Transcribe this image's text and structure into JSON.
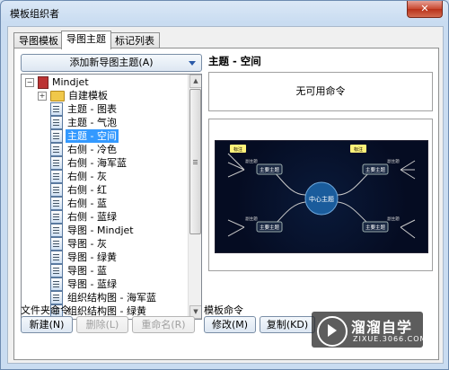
{
  "window": {
    "title": "模板组织者",
    "close_label": "✕"
  },
  "tabs": [
    {
      "label": "导图模板",
      "active": false
    },
    {
      "label": "导图主题",
      "active": true
    },
    {
      "label": "标记列表",
      "active": false
    }
  ],
  "add_theme_button": "添加新导图主题(A)",
  "tree": {
    "root": "Mindjet",
    "folder": "自建模板",
    "items": [
      "主题 - 图表",
      "主题 - 气泡",
      "主题 - 空间",
      "右侧 - 冷色",
      "右侧 - 海军蓝",
      "右侧 - 灰",
      "右侧 - 红",
      "右侧 - 蓝",
      "右侧 - 蓝绿",
      "导图 - Mindjet",
      "导图 - 灰",
      "导图 - 绿黄",
      "导图 - 蓝",
      "导图 - 蓝绿",
      "组织结构图 - 海军蓝",
      "组织结构图 - 绿黄"
    ],
    "selected": "主题 - 空间"
  },
  "right_panel": {
    "title": "主题 - 空间",
    "command_text": "无可用命令"
  },
  "preview": {
    "center": "中心主题",
    "topics": [
      "主要主题",
      "主要主题",
      "主要主题",
      "主要主题"
    ],
    "callouts": [
      "标注",
      "标注"
    ],
    "subtopic": "副主题",
    "colors": {
      "background": "#06102a",
      "center": "#1a5c9c",
      "callout": "#fff27a",
      "line": "#c9c9c9"
    }
  },
  "file_commands": {
    "label": "文件夹命令",
    "new": "新建(N)",
    "delete": "删除(L)",
    "rename": "重命名(R)"
  },
  "template_commands": {
    "label": "模板命令",
    "edit": "修改(M)",
    "copy": "复制(KD)"
  },
  "watermark": {
    "title": "溜溜自学",
    "url": "ZIXUE.3066.COM"
  }
}
